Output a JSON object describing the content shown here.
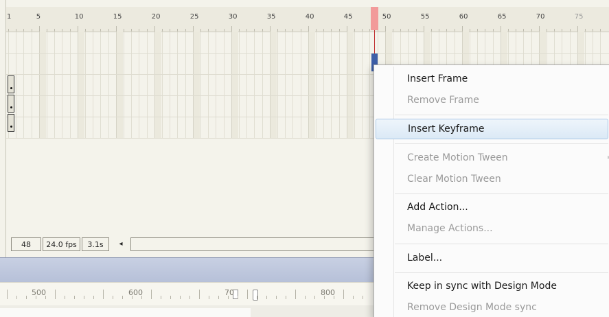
{
  "timeline": {
    "ruler_numbers": [
      "1",
      "5",
      "10",
      "15",
      "20",
      "25",
      "30",
      "35",
      "40",
      "45",
      "50",
      "55",
      "60",
      "65",
      "70",
      "75"
    ],
    "current_frame_marker": "48"
  },
  "status_bar": {
    "frame": "48",
    "fps": "24.0 fps",
    "time": "3.1s",
    "scroll_left_icon": "◂"
  },
  "design_ruler": {
    "labels": [
      "500",
      "600",
      "70",
      "800"
    ]
  },
  "context_menu": {
    "items": [
      {
        "label": "Insert Frame",
        "enabled": true
      },
      {
        "label": "Remove Frame",
        "enabled": false
      },
      {
        "label": "Insert Keyframe",
        "enabled": true,
        "highlighted": true
      },
      {
        "label": "Create Motion Tween",
        "enabled": false,
        "submenu": true
      },
      {
        "label": "Clear Motion Tween",
        "enabled": false
      },
      {
        "label": "Add Action...",
        "enabled": true
      },
      {
        "label": "Manage Actions...",
        "enabled": false
      },
      {
        "label": "Label...",
        "enabled": true
      },
      {
        "label": "Keep in sync with Design Mode",
        "enabled": true
      },
      {
        "label": "Remove Design Mode sync",
        "enabled": false
      }
    ],
    "submenu_arrow": "▸"
  },
  "colors": {
    "playhead": "#f29a9a",
    "selection_marker": "#3d5fa8",
    "menu_highlight": "#dbe9f6"
  }
}
